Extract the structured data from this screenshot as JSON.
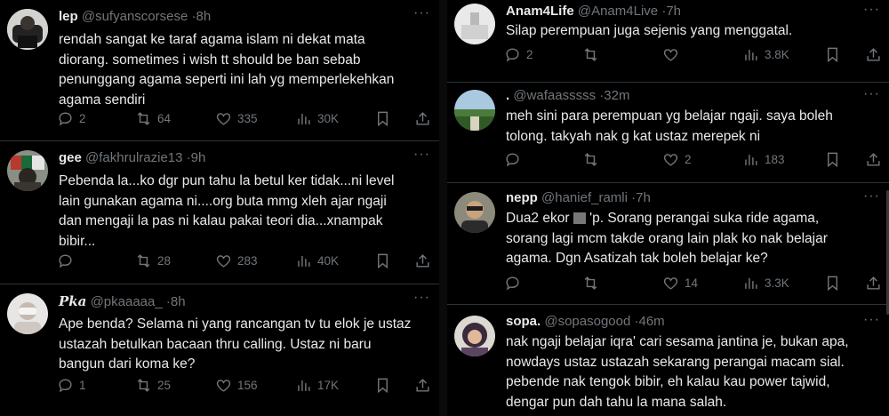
{
  "left": [
    {
      "name": "lep",
      "handle": "@sufyanscorsese",
      "time": "8h",
      "lines": [
        "rendah sangat ke taraf agama islam ni dekat mata",
        "diorang. sometimes i wish tt should be ban sebab",
        "penunggang agama seperti ini lah yg memperlekehkan",
        "agama sendiri"
      ],
      "replies": "2",
      "reposts": "64",
      "likes": "335",
      "views": "30K"
    },
    {
      "name": "gee",
      "handle": "@fakhrulrazie13",
      "time": "9h",
      "lines": [
        "Pebenda la...ko dgr pun tahu la betul ker tidak...ni level",
        "lain gunakan agama ni....org buta mmg xleh ajar ngaji",
        "dan mengaji la pas ni kalau pakai teori dia...xnampak",
        "bibir..."
      ],
      "replies": "",
      "reposts": "28",
      "likes": "283",
      "views": "40K"
    },
    {
      "name": "Pka",
      "handle": "@pkaaaaa_",
      "time": "8h",
      "lines": [
        "Ape benda? Selama ni yang rancangan tv tu elok je ustaz",
        "ustazah betulkan bacaan thru calling. Ustaz ni baru",
        "bangun dari koma ke?"
      ],
      "replies": "1",
      "reposts": "25",
      "likes": "156",
      "views": "17K"
    }
  ],
  "right": [
    {
      "name": "Anam4Life",
      "handle": "@Anam4Live",
      "time": "7h",
      "lines": [
        "Silap perempuan juga sejenis yang menggatal."
      ],
      "replies": "2",
      "reposts": "",
      "likes": "",
      "views": "3.8K"
    },
    {
      "name": ".",
      "handle": "@wafaasssss",
      "time": "32m",
      "lines": [
        "meh sini para perempuan yg belajar ngaji. saya boleh",
        "tolong. takyah nak g kat ustaz merepek ni"
      ],
      "replies": "",
      "reposts": "",
      "likes": "2",
      "views": "183"
    },
    {
      "name": "nepp",
      "handle": "@hanief_ramli",
      "time": "7h",
      "line1_a": "Dua2 ekor",
      "line1_b": "'p. Sorang perangai suka ride agama,",
      "lines": [
        "sorang lagi mcm takde orang lain plak ko nak belajar",
        "agama. Dgn Asatizah tak boleh belajar ke?"
      ],
      "replies": "",
      "reposts": "",
      "likes": "14",
      "views": "3.3K"
    },
    {
      "name": "sopa.",
      "handle": "@sopasogood",
      "time": "46m",
      "lines": [
        "nak ngaji belajar iqra' cari sesama jantina je, bukan apa,",
        "nowdays ustaz ustazah sekarang perangai macam sial.",
        "pebende nak tengok bibir, eh kalau kau power tajwid,",
        "dengar pun dah tahu la mana salah."
      ]
    }
  ],
  "sep": "·",
  "more": "···",
  "colors": {
    "bg": "#000000",
    "text": "#e7e9ea",
    "muted": "#71767b",
    "divider": "#2f3336"
  },
  "icons": [
    "reply-icon",
    "repost-icon",
    "like-icon",
    "views-icon",
    "bookmark-icon",
    "share-icon",
    "more-icon"
  ]
}
